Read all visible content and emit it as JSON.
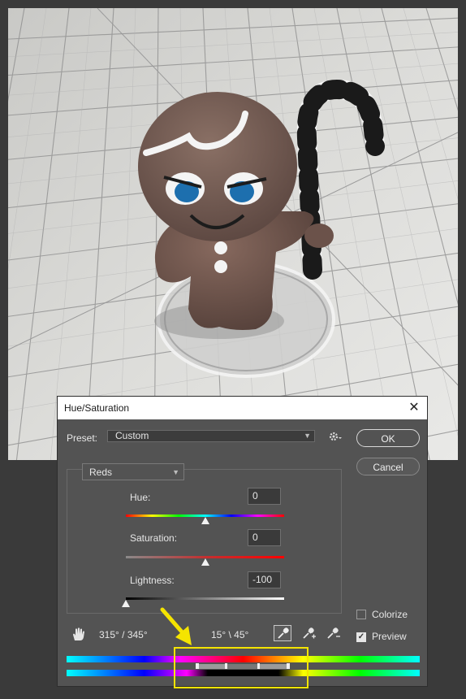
{
  "dialog": {
    "title": "Hue/Saturation",
    "close_glyph": "✕",
    "preset_label": "Preset:",
    "preset_value": "Custom",
    "ok_label": "OK",
    "cancel_label": "Cancel",
    "channel_value": "Reds",
    "hue": {
      "label": "Hue:",
      "value": "0",
      "level": 0.5
    },
    "saturation": {
      "label": "Saturation:",
      "value": "0",
      "level": 0.5
    },
    "lightness": {
      "label": "Lightness:",
      "value": "-100",
      "level": 0.0
    },
    "colorize_label": "Colorize",
    "colorize_checked": false,
    "preview_label": "Preview",
    "preview_checked": true,
    "range_left": "315° / 345°",
    "range_right": "15° \\ 45°",
    "icons": {
      "gear": "gear-icon",
      "hand": "targeted-adjustment-hand-icon",
      "eyedropper": "eyedropper-icon",
      "eyedropper_plus": "eyedropper-plus-icon",
      "eyedropper_minus": "eyedropper-minus-icon"
    }
  },
  "colors": {
    "dialog_bg": "#535353",
    "annotation_yellow": "#f5e400"
  }
}
